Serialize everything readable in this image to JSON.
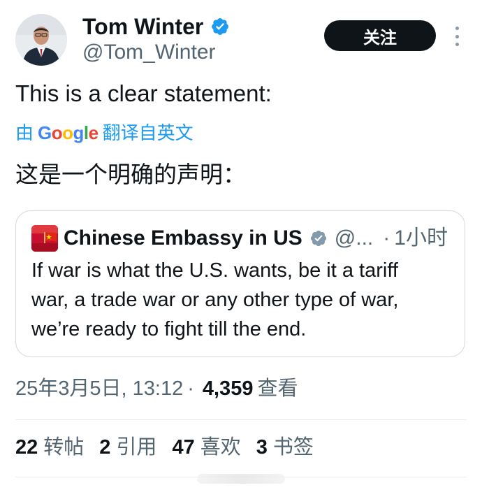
{
  "author": {
    "display_name": "Tom Winter",
    "handle": "@Tom_Winter",
    "verified_icon": "verified-badge-icon",
    "avatar_icon": "avatar-photo"
  },
  "actions": {
    "follow_label": "关注",
    "more_icon": "more-vertical-icon"
  },
  "tweet": {
    "text": "This is a clear statement:",
    "translated_by_prefix": "由",
    "translator_brand": [
      "G",
      "o",
      "o",
      "g",
      "l",
      "e"
    ],
    "translated_by_suffix": "翻译自英文",
    "translated_text": "这是一个明确的声明："
  },
  "quote": {
    "name": "Chinese Embassy in US",
    "handle": "@...",
    "dot": "·",
    "time": "1小时",
    "text_lines": [
      "If war is what the U.S. wants, be it a tariff",
      "war, a trade war or any other type of war,",
      "we’re ready to fight till the end."
    ],
    "avatar_icon": "flag-avatar"
  },
  "meta": {
    "timestamp": "25年3月5日, 13:12",
    "separator": "·",
    "views_count": "4,359",
    "views_label": "查看"
  },
  "stats": [
    {
      "num": "22",
      "label": "转帖"
    },
    {
      "num": "2",
      "label": "引用"
    },
    {
      "num": "47",
      "label": "喜欢"
    },
    {
      "num": "3",
      "label": "书签"
    }
  ],
  "colors": {
    "link_blue": "#1d9bf0",
    "text_primary": "#0f1419",
    "text_secondary": "#536471",
    "border": "#cfd9de",
    "button_bg": "#0f1419"
  }
}
